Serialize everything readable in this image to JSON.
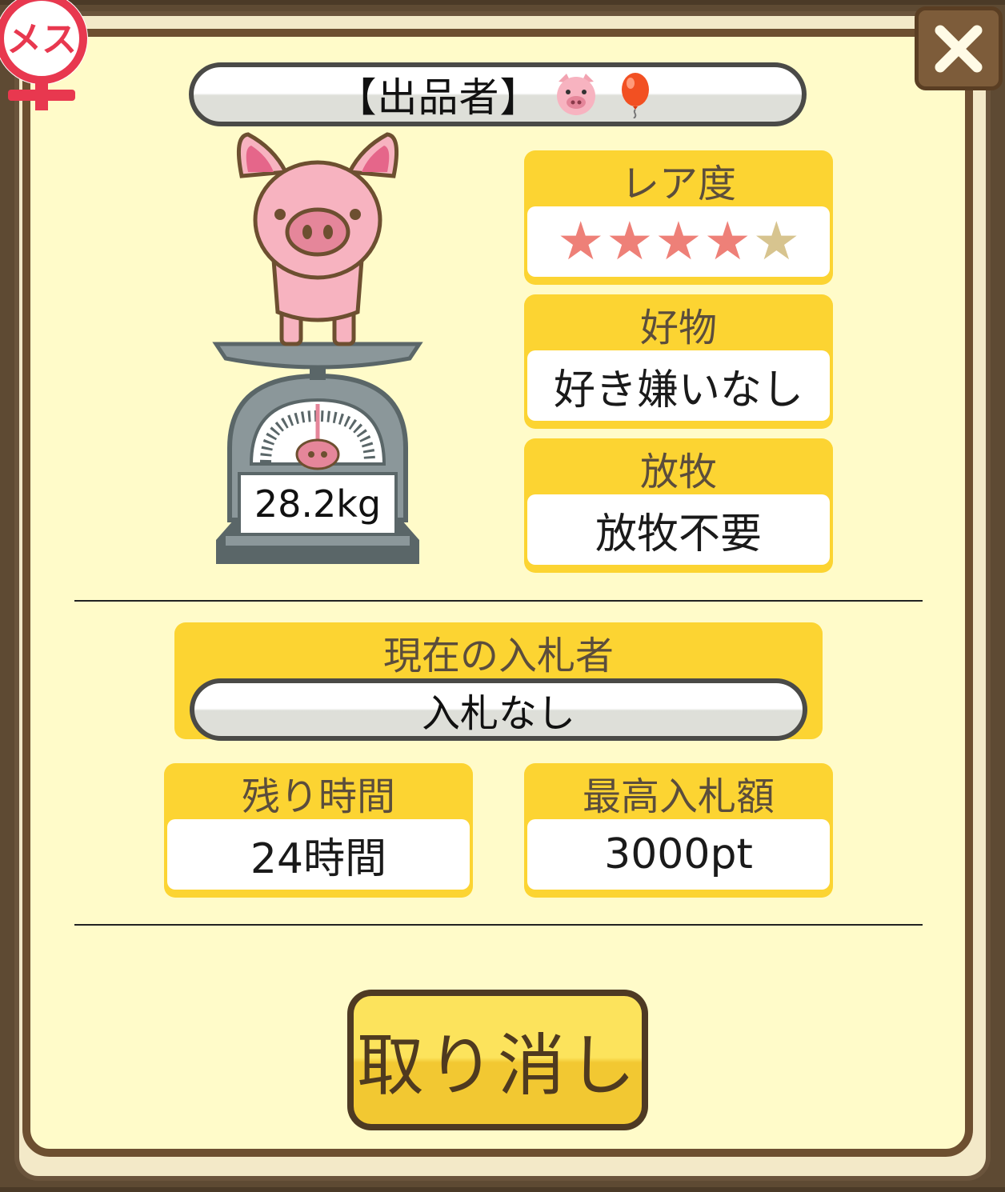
{
  "gender": {
    "label": "メス",
    "color": "#e8384f"
  },
  "close": {
    "icon": "close-icon"
  },
  "seller": {
    "label": "【出品者】",
    "icons": [
      "pig-face-icon",
      "balloon-icon"
    ]
  },
  "pig": {
    "weight": "28.2kg"
  },
  "rarity": {
    "title": "レア度",
    "rating": 4,
    "max": 5
  },
  "favorite": {
    "title": "好物",
    "value": "好き嫌いなし"
  },
  "grazing": {
    "title": "放牧",
    "value": "放牧不要"
  },
  "bidder": {
    "title": "現在の入札者",
    "value": "入札なし"
  },
  "remaining": {
    "title": "残り時間",
    "value": "24時間"
  },
  "max_bid": {
    "title": "最高入札額",
    "value": "3000pt"
  },
  "cancel": {
    "label": "取り消し"
  },
  "colors": {
    "panel": "#fffbc9",
    "frame": "#6d4f30",
    "box": "#fcd432",
    "star_on": "#ee8078",
    "star_off": "#d7c48f"
  }
}
